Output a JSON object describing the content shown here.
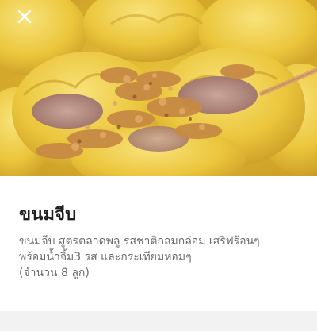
{
  "photo": {
    "subject": "Khanom jeeb dumplings topped with fried garlic",
    "colors": {
      "wrapper": "#e9c53a",
      "wrapper_light": "#f6dd62",
      "pork": "#b8938a",
      "garlic": "#c98a45",
      "background": "#d9b02c"
    }
  },
  "toolbar": {
    "close_icon": "close-icon"
  },
  "item": {
    "title": "ขนมจีบ",
    "description_lines": [
      "ขนมจีบ สูตรตลาดพลู  รสชาติกลมกล่อม เสริฟร้อนๆ",
      "พร้อมน้ำจิ้ม3 รส และกระเทียมหอมๆ",
      "(จำนวน 8 ลูก)"
    ]
  }
}
